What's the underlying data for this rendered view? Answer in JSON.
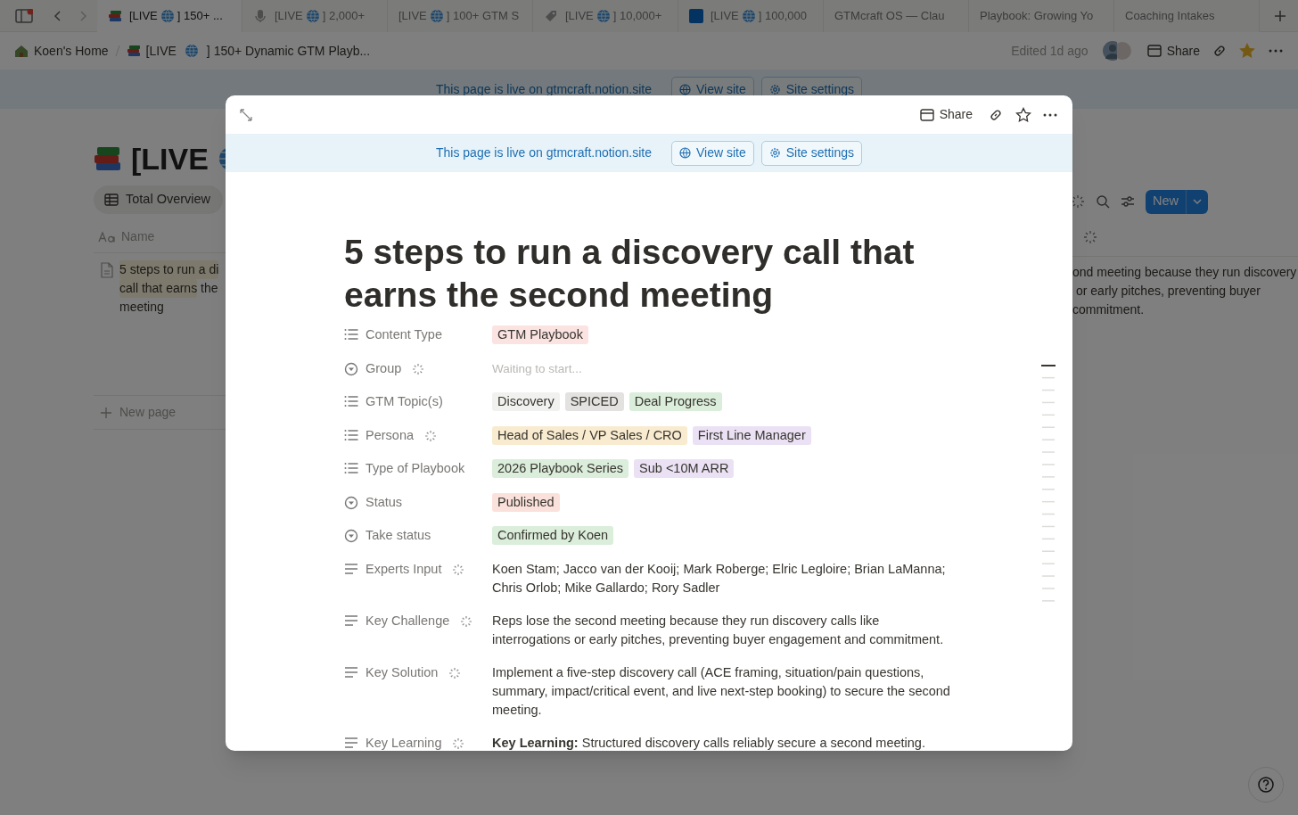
{
  "browser_tabs": [
    {
      "label_start": "[LIVE",
      "label_end": "] 150+ ...",
      "selected": true
    },
    {
      "label_start": "[LIVE",
      "label_end": "] 2,000+",
      "selected": false
    },
    {
      "label_start": "[LIVE",
      "label_end": "] 100+ GTM S",
      "selected": false
    },
    {
      "label_start": "[LIVE",
      "label_end": "] 10,000+",
      "selected": false
    },
    {
      "label_start": "[LIVE",
      "label_end": "] 100,000",
      "selected": false
    },
    {
      "label": "GTMcraft OS — Clau",
      "selected": false
    },
    {
      "label": "Playbook: Growing Yo",
      "selected": false
    },
    {
      "label": "Coaching Intakes",
      "selected": false
    }
  ],
  "breadcrumb": {
    "home": "Koen's Home",
    "page_start": "[LIVE",
    "page_end": "] 150+ Dynamic GTM Playb..."
  },
  "top_actions": {
    "edited": "Edited 1d ago",
    "share": "Share",
    "favorite": true
  },
  "background_banner": {
    "text": "This page is live on gtmcraft.notion.site",
    "view_site": "View site",
    "site_settings": "Site settings"
  },
  "database": {
    "title": "[LIVE",
    "view_tab": "Total Overview",
    "name_column": "Name",
    "name_lines": [
      {
        "text": "5 steps to run a di",
        "highlighted": true
      },
      {
        "text": "call that earns",
        "highlighted": true,
        "rest": " the"
      },
      {
        "text": "meeting",
        "highlighted": false
      }
    ],
    "new_page": "New page",
    "new_button": "New",
    "cell_lines": [
      "ond meeting because they run discovery",
      "or early pitches, preventing buyer",
      "commitment."
    ]
  },
  "peek": {
    "share": "Share",
    "banner": {
      "text": "This page is live on gtmcraft.notion.site",
      "view_site": "View site",
      "site_settings": "Site settings"
    },
    "title": "5 steps to run a discovery call that earns the second meeting",
    "properties": [
      {
        "kind": "multi_select",
        "label": "Content Type",
        "ai": false,
        "tags": [
          {
            "text": "GTM Playbook",
            "color": "#fbe3e2"
          }
        ]
      },
      {
        "kind": "status",
        "label": "Group",
        "ai": true,
        "placeholder": "Waiting to start..."
      },
      {
        "kind": "multi_select",
        "label": "GTM Topic(s)",
        "ai": false,
        "tags": [
          {
            "text": "Discovery",
            "color": "#f1f1ef"
          },
          {
            "text": "SPICED",
            "color": "#e3e2e0"
          },
          {
            "text": "Deal Progress",
            "color": "#dbeddb"
          }
        ]
      },
      {
        "kind": "multi_select",
        "label": "Persona",
        "ai": true,
        "tags": [
          {
            "text": "Head of Sales / VP Sales / CRO",
            "color": "#f9ebcf"
          },
          {
            "text": "First Line Manager",
            "color": "#ebe1f4"
          }
        ]
      },
      {
        "kind": "multi_select",
        "label": "Type of Playbook",
        "ai": false,
        "tags": [
          {
            "text": "2026 Playbook Series",
            "color": "#dbeddb"
          },
          {
            "text": "Sub <10M ARR",
            "color": "#ebe1f4"
          }
        ]
      },
      {
        "kind": "status",
        "label": "Status",
        "ai": false,
        "tags": [
          {
            "text": "Published",
            "color": "#fbe1dc"
          }
        ]
      },
      {
        "kind": "status",
        "label": "Take status",
        "ai": false,
        "tags": [
          {
            "text": "Confirmed by Koen",
            "color": "#dbeddb"
          }
        ]
      },
      {
        "kind": "text",
        "label": "Experts Input",
        "ai": true,
        "text": "Koen Stam; Jacco van der Kooij; Mark Roberge; Elric Legloire; Brian LaManna; Chris Orlob; Mike Gallardo; Rory Sadler"
      },
      {
        "kind": "text",
        "label": "Key Challenge",
        "ai": true,
        "text": "Reps lose the second meeting because they run discovery calls like interrogations or early pitches, preventing buyer engagement and commitment."
      },
      {
        "kind": "text",
        "label": "Key Solution",
        "ai": true,
        "text": "Implement a five-step discovery call (ACE framing, situation/pain questions, summary, impact/critical event, and live next-step booking) to secure the second meeting."
      },
      {
        "kind": "text",
        "label": "Key Learning",
        "ai": true,
        "text": "**Key Learning:** Structured discovery calls reliably secure a second meeting."
      }
    ]
  }
}
